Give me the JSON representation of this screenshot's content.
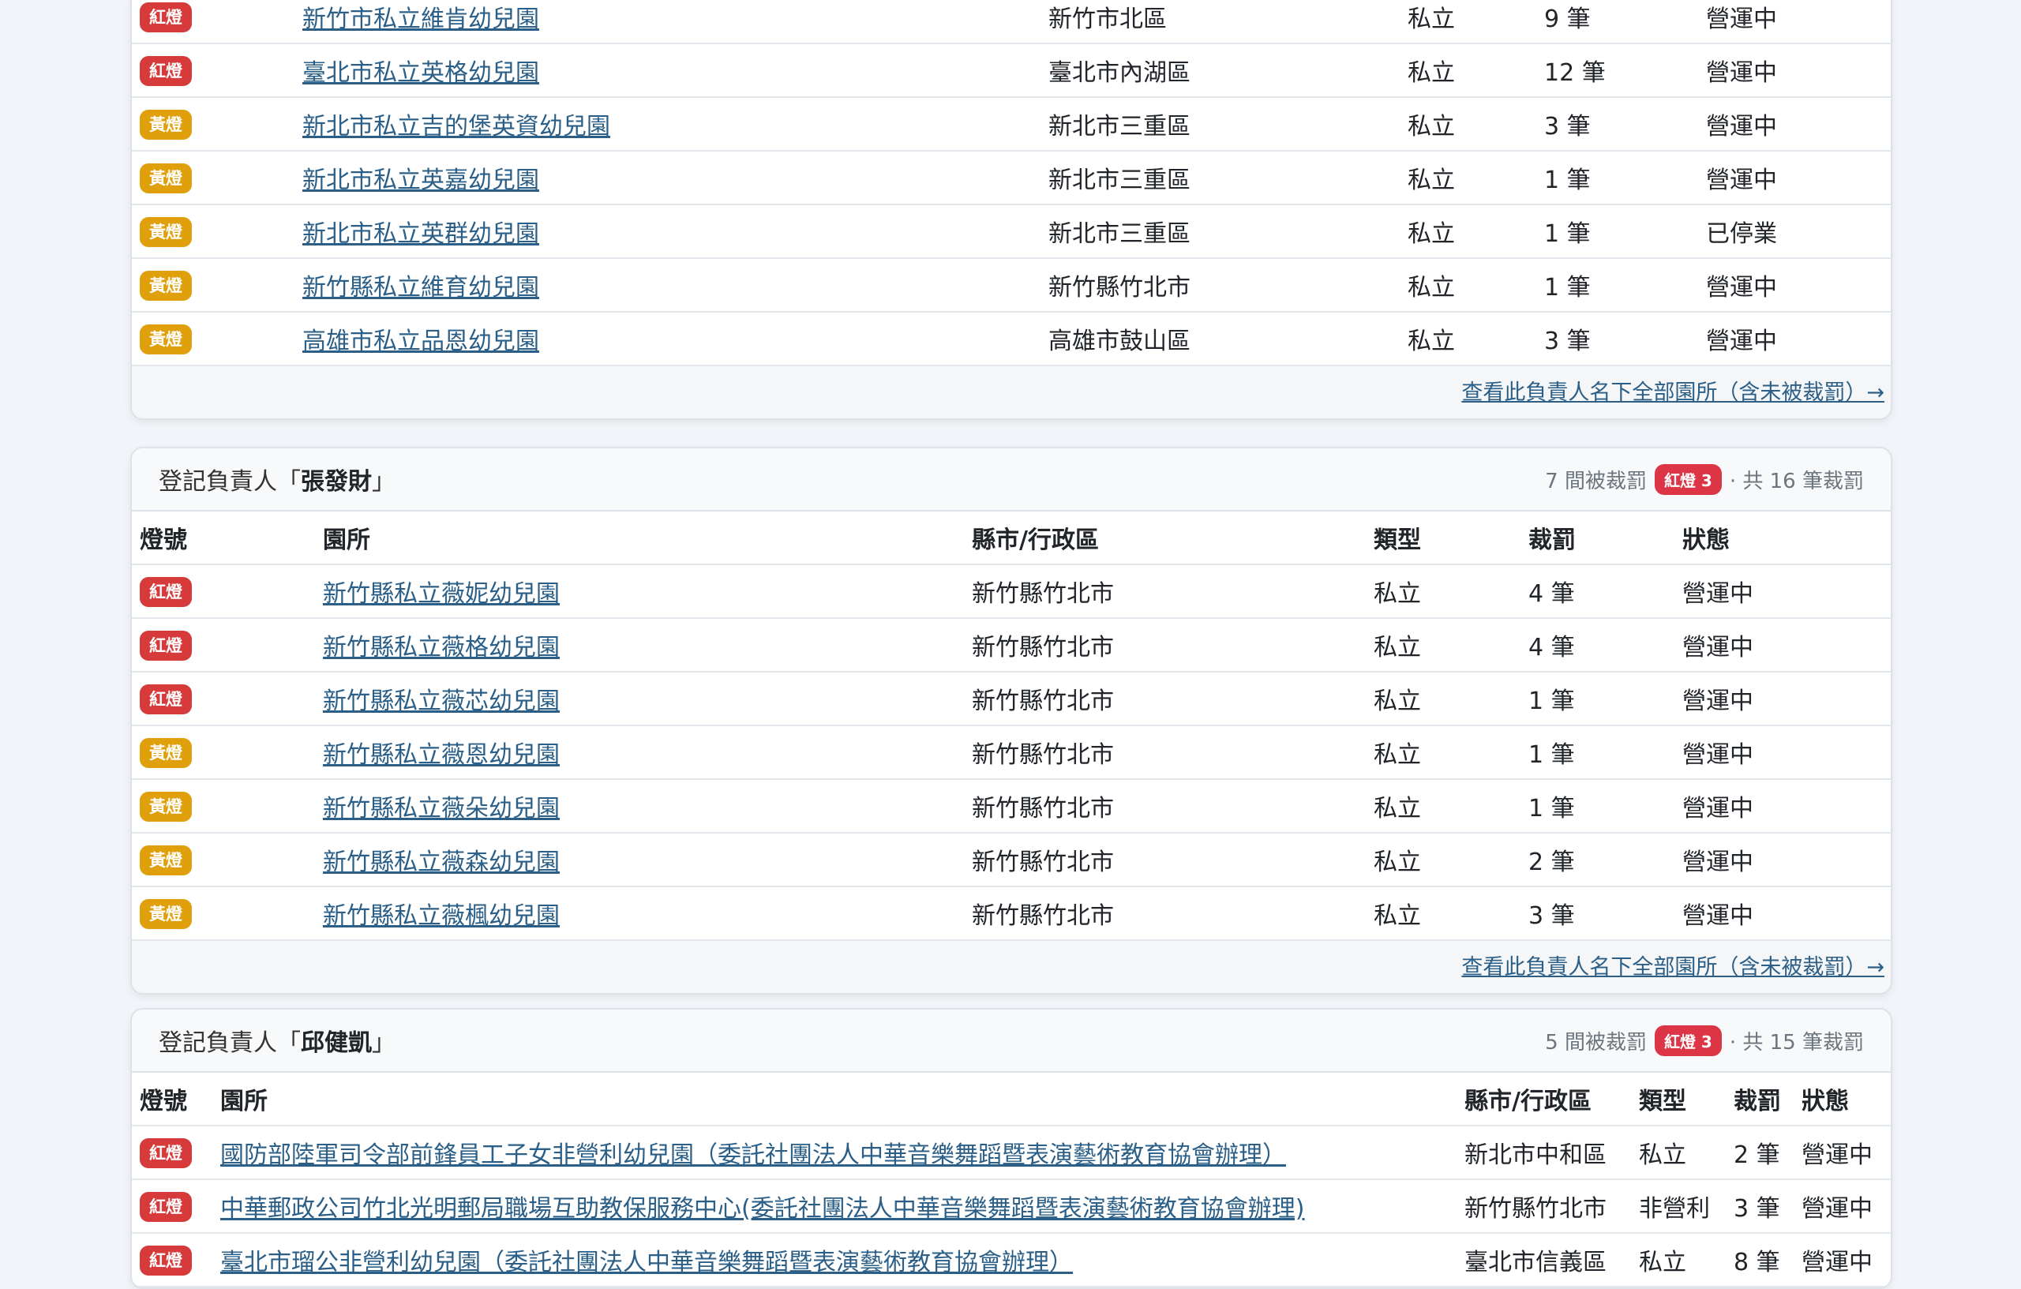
{
  "card1": {
    "rows": [
      {
        "light": "紅燈",
        "kind": "red",
        "name": "新竹市私立維肯幼兒園",
        "area": "新竹市北區",
        "type": "私立",
        "count": "9 筆",
        "status": "營運中"
      },
      {
        "light": "紅燈",
        "kind": "red",
        "name": "臺北市私立英格幼兒園",
        "area": "臺北市內湖區",
        "type": "私立",
        "count": "12 筆",
        "status": "營運中"
      },
      {
        "light": "黃燈",
        "kind": "yellow",
        "name": "新北市私立吉的堡英資幼兒園",
        "area": "新北市三重區",
        "type": "私立",
        "count": "3 筆",
        "status": "營運中"
      },
      {
        "light": "黃燈",
        "kind": "yellow",
        "name": "新北市私立英嘉幼兒園",
        "area": "新北市三重區",
        "type": "私立",
        "count": "1 筆",
        "status": "營運中"
      },
      {
        "light": "黃燈",
        "kind": "yellow",
        "name": "新北市私立英群幼兒園",
        "area": "新北市三重區",
        "type": "私立",
        "count": "1 筆",
        "status": "已停業"
      },
      {
        "light": "黃燈",
        "kind": "yellow",
        "name": "新竹縣私立維育幼兒園",
        "area": "新竹縣竹北市",
        "type": "私立",
        "count": "1 筆",
        "status": "營運中"
      },
      {
        "light": "黃燈",
        "kind": "yellow",
        "name": "高雄市私立品恩幼兒園",
        "area": "高雄市鼓山區",
        "type": "私立",
        "count": "3 筆",
        "status": "營運中"
      }
    ],
    "footer_link": "查看此負責人名下全部園所（含未被裁罰）→"
  },
  "card2": {
    "prefix": "登記負責人「",
    "name": "張發財",
    "suffix": "」",
    "meta_left": "7 間被裁罰",
    "meta_badge": "紅燈 3",
    "meta_right": "· 共 16 筆裁罰",
    "headers": [
      "燈號",
      "園所",
      "縣市/行政區",
      "類型",
      "裁罰",
      "狀態"
    ],
    "rows": [
      {
        "light": "紅燈",
        "kind": "red",
        "name": "新竹縣私立薇妮幼兒園",
        "area": "新竹縣竹北市",
        "type": "私立",
        "count": "4 筆",
        "status": "營運中"
      },
      {
        "light": "紅燈",
        "kind": "red",
        "name": "新竹縣私立薇格幼兒園",
        "area": "新竹縣竹北市",
        "type": "私立",
        "count": "4 筆",
        "status": "營運中"
      },
      {
        "light": "紅燈",
        "kind": "red",
        "name": "新竹縣私立薇芯幼兒園",
        "area": "新竹縣竹北市",
        "type": "私立",
        "count": "1 筆",
        "status": "營運中"
      },
      {
        "light": "黃燈",
        "kind": "yellow",
        "name": "新竹縣私立薇恩幼兒園",
        "area": "新竹縣竹北市",
        "type": "私立",
        "count": "1 筆",
        "status": "營運中"
      },
      {
        "light": "黃燈",
        "kind": "yellow",
        "name": "新竹縣私立薇朵幼兒園",
        "area": "新竹縣竹北市",
        "type": "私立",
        "count": "1 筆",
        "status": "營運中"
      },
      {
        "light": "黃燈",
        "kind": "yellow",
        "name": "新竹縣私立薇森幼兒園",
        "area": "新竹縣竹北市",
        "type": "私立",
        "count": "2 筆",
        "status": "營運中"
      },
      {
        "light": "黃燈",
        "kind": "yellow",
        "name": "新竹縣私立薇楓幼兒園",
        "area": "新竹縣竹北市",
        "type": "私立",
        "count": "3 筆",
        "status": "營運中"
      }
    ],
    "footer_link": "查看此負責人名下全部園所（含未被裁罰）→"
  },
  "card3": {
    "prefix": "登記負責人「",
    "name": "邱健凱",
    "suffix": "」",
    "meta_left": "5 間被裁罰",
    "meta_badge": "紅燈 3",
    "meta_right": "· 共 15 筆裁罰",
    "headers": [
      "燈號",
      "園所",
      "縣市/行政區",
      "類型",
      "裁罰",
      "狀態"
    ],
    "rows": [
      {
        "light": "紅燈",
        "kind": "red",
        "name": "國防部陸軍司令部前鋒員工子女非營利幼兒園（委託社團法人中華音樂舞蹈暨表演藝術教育協會辦理）",
        "area": "新北市中和區",
        "type": "私立",
        "count": "2 筆",
        "status": "營運中"
      },
      {
        "light": "紅燈",
        "kind": "red",
        "name": "中華郵政公司竹北光明郵局職場互助教保服務中心(委託社團法人中華音樂舞蹈暨表演藝術教育協會辦理)",
        "area": "新竹縣竹北市",
        "type": "非營利",
        "count": "3 筆",
        "status": "營運中"
      },
      {
        "light": "紅燈",
        "kind": "red",
        "name": "臺北市瑠公非營利幼兒園（委託社團法人中華音樂舞蹈暨表演藝術教育協會辦理）",
        "area": "臺北市信義區",
        "type": "私立",
        "count": "8 筆",
        "status": "營運中"
      }
    ]
  },
  "colors": {
    "red": "#d63a3a",
    "yellow": "#e0a00c",
    "link": "#2b5f87"
  }
}
